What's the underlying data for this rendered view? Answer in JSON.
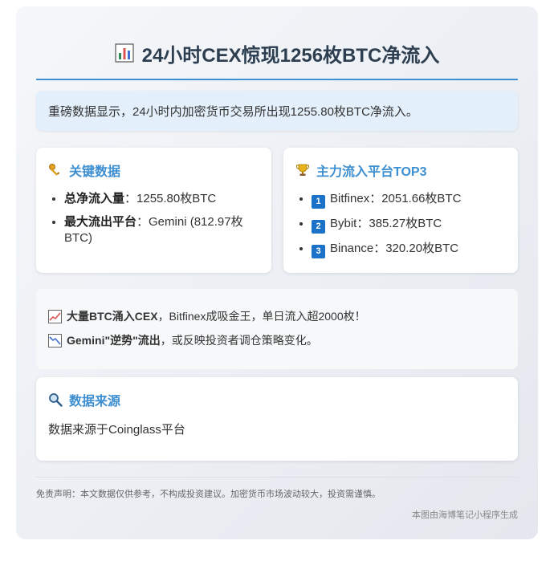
{
  "title": "24小时CEX惊现1256枚BTC净流入",
  "intro": "重磅数据显示，24小时内加密货币交易所出现1255.80枚BTC净流入。",
  "key_data": {
    "heading": "关键数据",
    "items": [
      {
        "label": "总净流入量",
        "value": "：1255.80枚BTC"
      },
      {
        "label": "最大流出平台",
        "value": "：Gemini (812.97枚BTC)"
      }
    ]
  },
  "top3": {
    "heading": "主力流入平台TOP3",
    "items": [
      {
        "rank": "1",
        "text": "Bitfinex：2051.66枚BTC"
      },
      {
        "rank": "2",
        "text": "Bybit：385.27枚BTC"
      },
      {
        "rank": "3",
        "text": "Binance：320.20枚BTC"
      }
    ]
  },
  "highlights": [
    {
      "icon": "chart-up-icon",
      "bold": "大量BTC涌入CEX",
      "text": "，Bitfinex成吸金王，单日流入超2000枚！"
    },
    {
      "icon": "chart-down-icon",
      "bold": "Gemini\"逆势\"流出",
      "text": "，或反映投资者调仓策略变化。"
    }
  ],
  "source": {
    "heading": "数据来源",
    "text": "数据来源于Coinglass平台"
  },
  "footer": {
    "disclaimer": "免责声明：本文数据仅供参考，不构成投资建议。加密货币市场波动较大，投资需谨慎。",
    "credit": "本图由海博笔记小程序生成"
  },
  "colors": {
    "accent": "#3d8fd1",
    "title": "#2c3e50",
    "rank_badge": "#1a73c9"
  }
}
